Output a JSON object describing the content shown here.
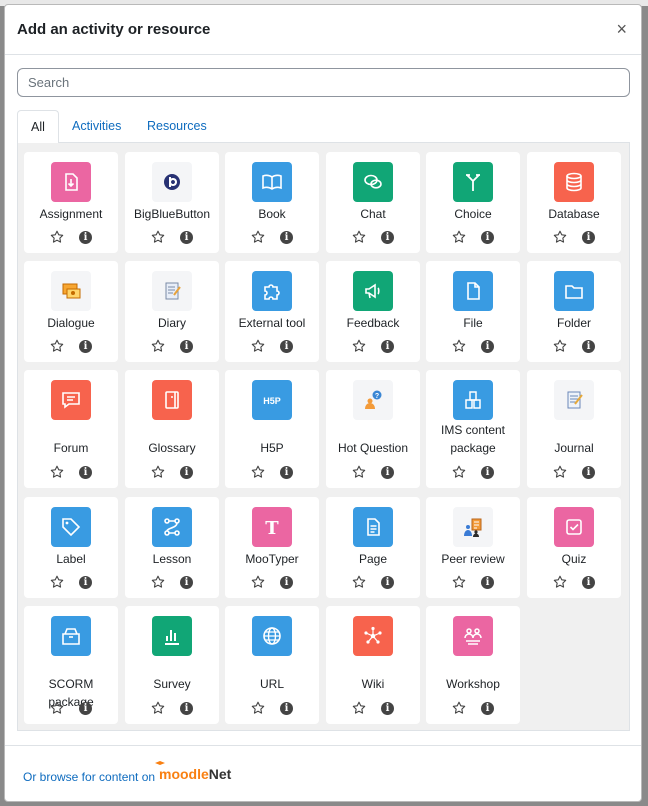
{
  "modal": {
    "title": "Add an activity or resource",
    "close_glyph": "×"
  },
  "search": {
    "placeholder": "Search",
    "value": ""
  },
  "tabs": [
    {
      "label": "All",
      "active": true
    },
    {
      "label": "Activities",
      "active": false
    },
    {
      "label": "Resources",
      "active": false
    }
  ],
  "items": [
    {
      "label": "Assignment",
      "icon": "assignment-icon",
      "color": "#eb66a2"
    },
    {
      "label": "BigBlueButton",
      "icon": "bigbluebutton-icon",
      "color": "#f4f5f7"
    },
    {
      "label": "Book",
      "icon": "book-icon",
      "color": "#399be2"
    },
    {
      "label": "Chat",
      "icon": "chat-icon",
      "color": "#11a676"
    },
    {
      "label": "Choice",
      "icon": "choice-icon",
      "color": "#11a676"
    },
    {
      "label": "Database",
      "icon": "database-icon",
      "color": "#f7634d"
    },
    {
      "label": "Dialogue",
      "icon": "dialogue-icon",
      "color": "#f4f5f7"
    },
    {
      "label": "Diary",
      "icon": "diary-icon",
      "color": "#f4f5f7"
    },
    {
      "label": "External tool",
      "icon": "puzzle-icon",
      "color": "#399be2"
    },
    {
      "label": "Feedback",
      "icon": "megaphone-icon",
      "color": "#11a676"
    },
    {
      "label": "File",
      "icon": "file-icon",
      "color": "#399be2"
    },
    {
      "label": "Folder",
      "icon": "folder-icon",
      "color": "#399be2"
    },
    {
      "label": "Forum",
      "icon": "forum-icon",
      "color": "#f7634d"
    },
    {
      "label": "Glossary",
      "icon": "glossary-icon",
      "color": "#f7634d"
    },
    {
      "label": "H5P",
      "icon": "h5p-icon",
      "color": "#399be2"
    },
    {
      "label": "Hot Question",
      "icon": "hot-question-icon",
      "color": "#f4f5f7"
    },
    {
      "label": "IMS content package",
      "icon": "ims-package-icon",
      "color": "#399be2"
    },
    {
      "label": "Journal",
      "icon": "journal-icon",
      "color": "#f4f5f7"
    },
    {
      "label": "Label",
      "icon": "tag-icon",
      "color": "#399be2"
    },
    {
      "label": "Lesson",
      "icon": "lesson-icon",
      "color": "#399be2"
    },
    {
      "label": "MooTyper",
      "icon": "mootyper-icon",
      "color": "#eb66a2"
    },
    {
      "label": "Page",
      "icon": "page-icon",
      "color": "#399be2"
    },
    {
      "label": "Peer review",
      "icon": "peer-review-icon",
      "color": "#f4f5f7"
    },
    {
      "label": "Quiz",
      "icon": "quiz-icon",
      "color": "#eb66a2"
    },
    {
      "label": "SCORM package",
      "icon": "scorm-icon",
      "color": "#399be2"
    },
    {
      "label": "Survey",
      "icon": "survey-icon",
      "color": "#11a676"
    },
    {
      "label": "URL",
      "icon": "globe-icon",
      "color": "#399be2"
    },
    {
      "label": "Wiki",
      "icon": "wiki-icon",
      "color": "#f7634d"
    },
    {
      "label": "Workshop",
      "icon": "workshop-icon",
      "color": "#eb66a2"
    }
  ],
  "footer": {
    "browse_text": "Or browse for content on",
    "brand_part1": "moodle",
    "brand_part2": "Net"
  }
}
